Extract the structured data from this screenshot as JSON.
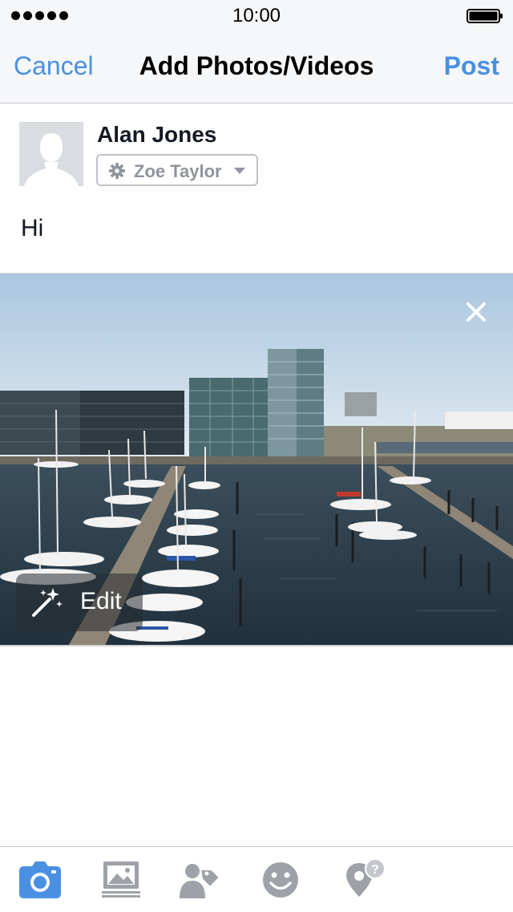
{
  "status_bar": {
    "time": "10:00",
    "signal_dots": 5
  },
  "nav": {
    "cancel_label": "Cancel",
    "title": "Add Photos/Videos",
    "post_label": "Post"
  },
  "composer": {
    "user_name": "Alan Jones",
    "audience_label": "Zoe Taylor",
    "status_text": "Hi"
  },
  "photo": {
    "edit_label": "Edit"
  },
  "toolbar": {
    "items": [
      {
        "icon": "camera-icon",
        "active": true
      },
      {
        "icon": "photo-album-icon",
        "active": false
      },
      {
        "icon": "tag-people-icon",
        "active": false
      },
      {
        "icon": "feeling-icon",
        "active": false
      },
      {
        "icon": "location-icon",
        "active": false
      }
    ]
  },
  "colors": {
    "accent": "#4a90e2",
    "icon_inactive": "#9ea2a8",
    "text_primary": "#141823",
    "text_secondary": "#90949c"
  }
}
